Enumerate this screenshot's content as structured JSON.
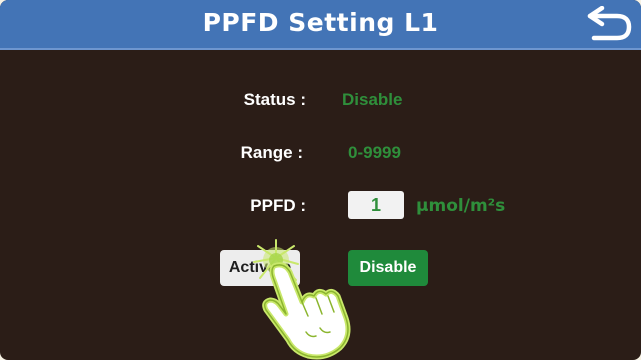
{
  "header": {
    "title": "PPFD Setting L1"
  },
  "status": {
    "label": "Status :",
    "value": "Disable"
  },
  "range": {
    "label": "Range :",
    "value": "0-9999"
  },
  "ppfd": {
    "label": "PPFD :",
    "value": "1",
    "unit": "µmol/m²s"
  },
  "buttons": {
    "activate": "Activate",
    "disable": "Disable"
  },
  "icons": {
    "back": "back-arrow-icon",
    "pointer": "tapping-hand-icon"
  },
  "colors": {
    "header": "#4374b6",
    "background": "#2b1d17",
    "accent_green": "#2f8f3b"
  }
}
